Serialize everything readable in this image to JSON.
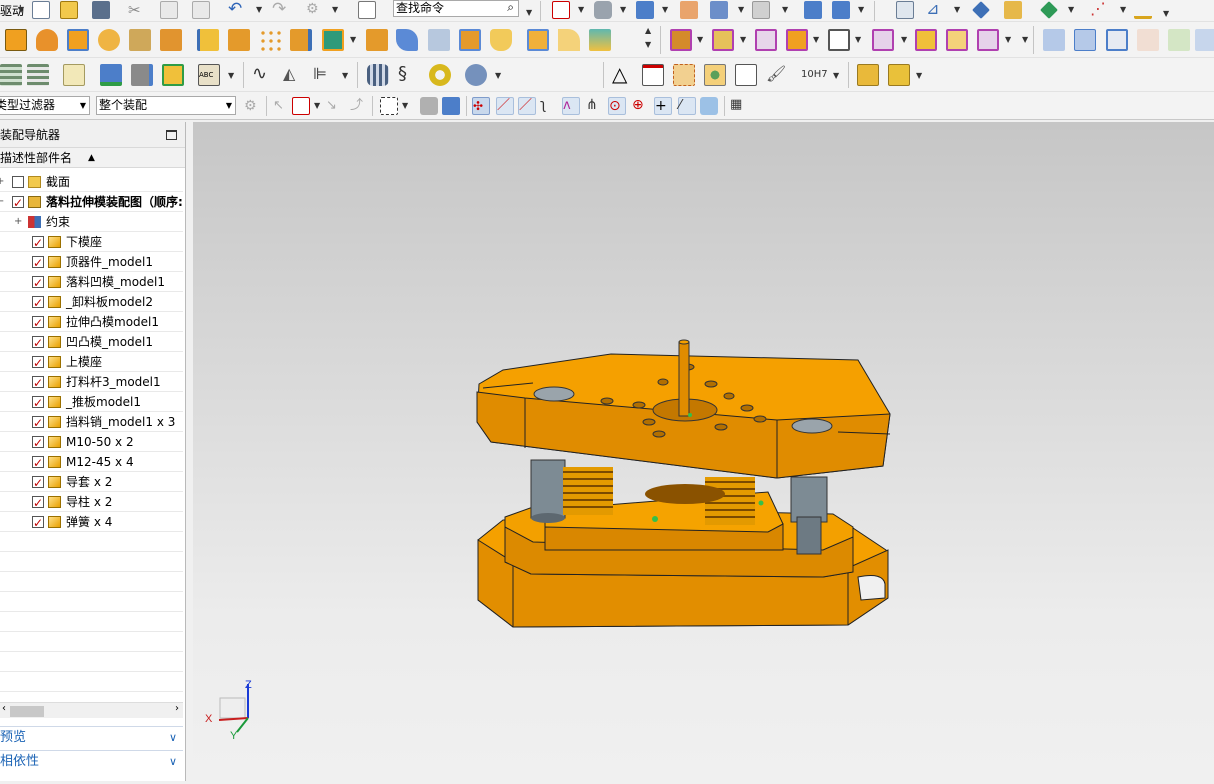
{
  "toolbar": {
    "command_search_placeholder": "查找命令",
    "menu_fragment": "驱动",
    "zoom_fit_label": "10H7"
  },
  "selection_bar": {
    "type_filter": "类型过滤器",
    "scope": "整个装配"
  },
  "navigator": {
    "title": "装配导航器",
    "column_header": "描述性部件名",
    "items": [
      {
        "label": "截面",
        "checked": false,
        "icon": "folder-icon",
        "indent": 1
      },
      {
        "label": "落料拉伸模装配图（顺序:",
        "checked": true,
        "icon": "assembly-icon",
        "indent": 1,
        "bold": true
      },
      {
        "label": "约束",
        "checked": null,
        "icon": "constraints-icon",
        "indent": 2
      },
      {
        "label": "下模座",
        "checked": true,
        "icon": "part-icon",
        "indent": 3
      },
      {
        "label": "顶器件_model1",
        "checked": true,
        "icon": "part-icon",
        "indent": 3
      },
      {
        "label": "落料凹模_model1",
        "checked": true,
        "icon": "part-icon",
        "indent": 3
      },
      {
        "label": "_卸料板model2",
        "checked": true,
        "icon": "part-icon",
        "indent": 3
      },
      {
        "label": "拉伸凸模model1",
        "checked": true,
        "icon": "part-icon",
        "indent": 3
      },
      {
        "label": "凹凸模_model1",
        "checked": true,
        "icon": "part-icon",
        "indent": 3
      },
      {
        "label": "上模座",
        "checked": true,
        "icon": "part-icon",
        "indent": 3
      },
      {
        "label": "打料杆3_model1",
        "checked": true,
        "icon": "part-icon",
        "indent": 3
      },
      {
        "label": "_推板model1",
        "checked": true,
        "icon": "part-icon",
        "indent": 3
      },
      {
        "label": "挡料销_model1 x 3",
        "checked": true,
        "icon": "part-icon",
        "indent": 3
      },
      {
        "label": "M10-50 x 2",
        "checked": true,
        "icon": "part-icon",
        "indent": 3
      },
      {
        "label": "M12-45 x 4",
        "checked": true,
        "icon": "part-icon",
        "indent": 3
      },
      {
        "label": "导套 x 2",
        "checked": true,
        "icon": "part-icon",
        "indent": 3
      },
      {
        "label": "导柱 x 2",
        "checked": true,
        "icon": "part-icon",
        "indent": 3
      },
      {
        "label": "弹簧 x 4",
        "checked": true,
        "icon": "part-icon",
        "indent": 3
      }
    ],
    "panels": [
      {
        "label": "预览"
      },
      {
        "label": "相依性"
      }
    ]
  },
  "triad": {
    "x": "X",
    "y": "Y",
    "z": "Z"
  },
  "colors": {
    "part": "#f5a000",
    "part_edge": "#222222",
    "checkbox": "#c00000",
    "spring": "#e39a00",
    "pillar": "#7d8b94"
  }
}
